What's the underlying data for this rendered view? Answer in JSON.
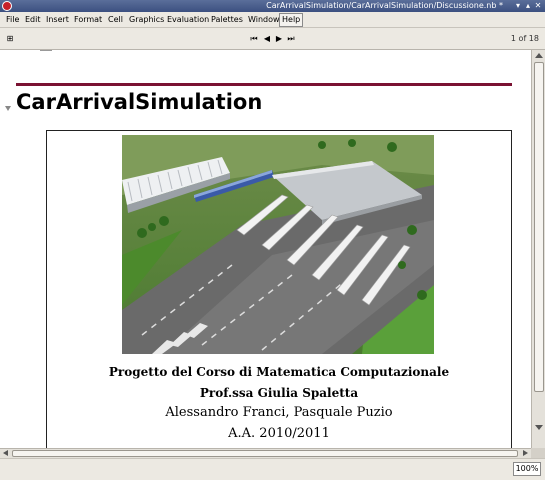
{
  "window": {
    "title": "CarArrivalSimulation/CarArrivalSimulation/Discussione.nb *",
    "buttons": [
      "▾",
      "▴",
      "✕"
    ]
  },
  "menu": [
    "File",
    "Edit",
    "Insert",
    "Format",
    "Cell",
    "Graphics",
    "Evaluation",
    "Palettes",
    "Window",
    "Help"
  ],
  "toolbar": {
    "left_icon": "⊞",
    "nav": [
      "⏮",
      "◀",
      "▶",
      "⏭"
    ],
    "page_indicator": "1 of 18"
  },
  "notebook": {
    "title": "CarArrivalSimulation",
    "caption_lines": [
      "Progetto del Corso di Matematica Computazionale",
      "Prof.ssa Giulia Spaletta",
      "Alessandro Franci, Pasquale Puzio",
      "A.A. 2010/2011"
    ]
  },
  "status": {
    "zoom": "100%"
  },
  "colors": {
    "header_rule": "#7a1232",
    "titlebar": "#3c5080",
    "chrome": "#ece9e2"
  },
  "icons": {
    "app": "mathematica-icon",
    "cell_bracket": "section-collapse-arrow-icon",
    "image": "toll-plaza-rendering"
  }
}
